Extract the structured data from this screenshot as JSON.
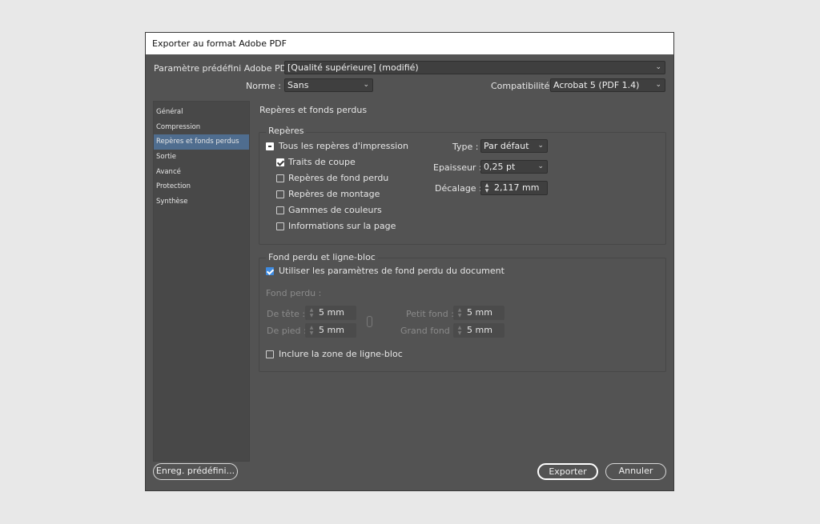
{
  "window": {
    "title": "Exporter au format Adobe PDF"
  },
  "preset": {
    "label": "Paramètre prédéfini Adobe PDF :",
    "value": "[Qualité supérieure] (modifié)"
  },
  "standard": {
    "label": "Norme  :",
    "value": "Sans"
  },
  "compat": {
    "label": "Compatibilité :",
    "value": "Acrobat 5 (PDF 1.4)"
  },
  "sidebar": {
    "items": [
      {
        "label": "Général"
      },
      {
        "label": "Compression"
      },
      {
        "label": "Repères et fonds perdus",
        "active": true
      },
      {
        "label": "Sortie"
      },
      {
        "label": "Avancé"
      },
      {
        "label": "Protection"
      },
      {
        "label": "Synthèse"
      }
    ]
  },
  "section_title": "Repères et fonds perdus",
  "marks": {
    "legend": "Repères",
    "all_marks": "Tous les repères d'impression",
    "crop_marks": "Traits de coupe",
    "bleed_marks": "Repères de fond perdu",
    "registration_marks": "Repères de montage",
    "color_bars": "Gammes de couleurs",
    "page_info": "Informations sur la page",
    "type_label": "Type :",
    "type_value": "Par défaut",
    "weight_label": "Epaisseur :",
    "weight_value": "0,25 pt",
    "offset_label": "Décalage :",
    "offset_value": "2,117 mm"
  },
  "bleed": {
    "legend": "Fond perdu et ligne-bloc",
    "use_doc": "Utiliser les paramètres de fond perdu du document",
    "bleed_label": "Fond perdu :",
    "top_label": "De tête :",
    "top_value": "5 mm",
    "bottom_label": "De pied :",
    "bottom_value": "5 mm",
    "inside_label": "Petit fond :",
    "inside_value": "5 mm",
    "outside_label": "Grand fond :",
    "outside_value": "5 mm",
    "include_slug": "Inclure la zone de ligne-bloc"
  },
  "buttons": {
    "save_preset": "Enreg. prédéfini...",
    "export": "Exporter",
    "cancel": "Annuler"
  },
  "colors": {
    "accent": "#3f8be0",
    "dialog_bg": "#535353",
    "active_item": "#4f6d8f"
  }
}
